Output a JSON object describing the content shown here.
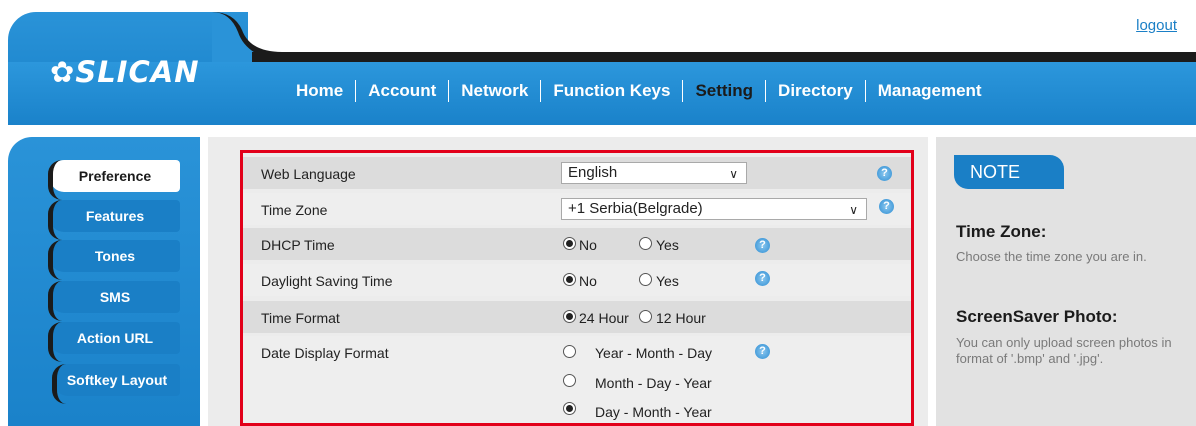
{
  "header": {
    "logo": "SLICAN",
    "logout": "logout",
    "nav": [
      "Home",
      "Account",
      "Network",
      "Function Keys",
      "Setting",
      "Directory",
      "Management"
    ],
    "active_nav": "Setting"
  },
  "sidebar": {
    "items": [
      "Preference",
      "Features",
      "Tones",
      "SMS",
      "Action URL",
      "Softkey Layout"
    ],
    "active": "Preference"
  },
  "settings": {
    "web_language": {
      "label": "Web Language",
      "value": "English"
    },
    "time_zone": {
      "label": "Time Zone",
      "value": "+1 Serbia(Belgrade)"
    },
    "dhcp_time": {
      "label": "DHCP Time",
      "opt_no": "No",
      "opt_yes": "Yes",
      "selected": "No"
    },
    "daylight_saving": {
      "label": "Daylight Saving Time",
      "opt_no": "No",
      "opt_yes": "Yes",
      "selected": "No"
    },
    "time_format": {
      "label": "Time Format",
      "opt_24": "24 Hour",
      "opt_12": "12 Hour",
      "selected": "24 Hour"
    },
    "date_display": {
      "label": "Date Display Format",
      "options": [
        "Year - Month - Day",
        "Month - Day - Year",
        "Day - Month - Year"
      ],
      "selected": "Day - Month - Year"
    }
  },
  "note": {
    "badge": "NOTE",
    "sections": [
      {
        "title": "Time Zone:",
        "text": "Choose the time zone you are in."
      },
      {
        "title": "ScreenSaver Photo:",
        "text": "You can only upload screen photos in format of '.bmp' and '.jpg'."
      }
    ]
  },
  "colors": {
    "accent": "#1a7fc6",
    "highlight": "#e2001a",
    "nav_active": "#1b1b1b"
  },
  "icons": {
    "help": "help-icon",
    "logo": "tree-icon"
  }
}
